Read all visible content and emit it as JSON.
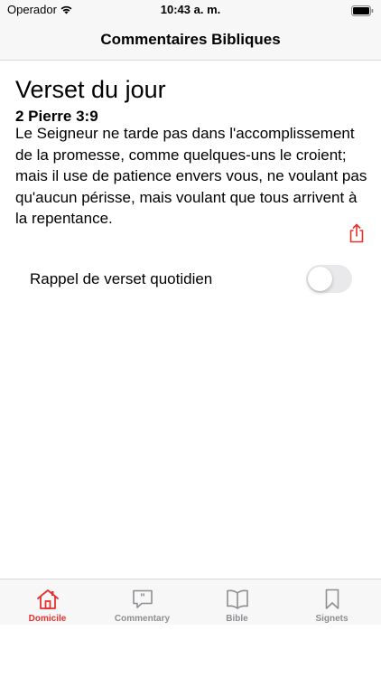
{
  "status_bar": {
    "carrier": "Operador",
    "time": "10:43 a. m."
  },
  "nav": {
    "title": "Commentaires Bibliques"
  },
  "verse": {
    "heading": "Verset du jour",
    "reference": "2 Pierre 3:9",
    "text": "Le Seigneur ne tarde pas dans l'accomplissement de la promesse, comme quelques-uns le croient; mais il use de patience envers vous, ne voulant pas qu'aucun périsse, mais voulant que tous arrivent à la repentance."
  },
  "reminder": {
    "label": "Rappel de verset quotidien",
    "enabled": false
  },
  "tabs": [
    {
      "label": "Domicile",
      "icon": "home-icon",
      "active": true
    },
    {
      "label": "Commentary",
      "icon": "comment-icon",
      "active": false
    },
    {
      "label": "Bible",
      "icon": "book-icon",
      "active": false
    },
    {
      "label": "Signets",
      "icon": "bookmark-icon",
      "active": false
    }
  ],
  "colors": {
    "accent": "#e5322d",
    "inactive": "#8e8e93"
  }
}
